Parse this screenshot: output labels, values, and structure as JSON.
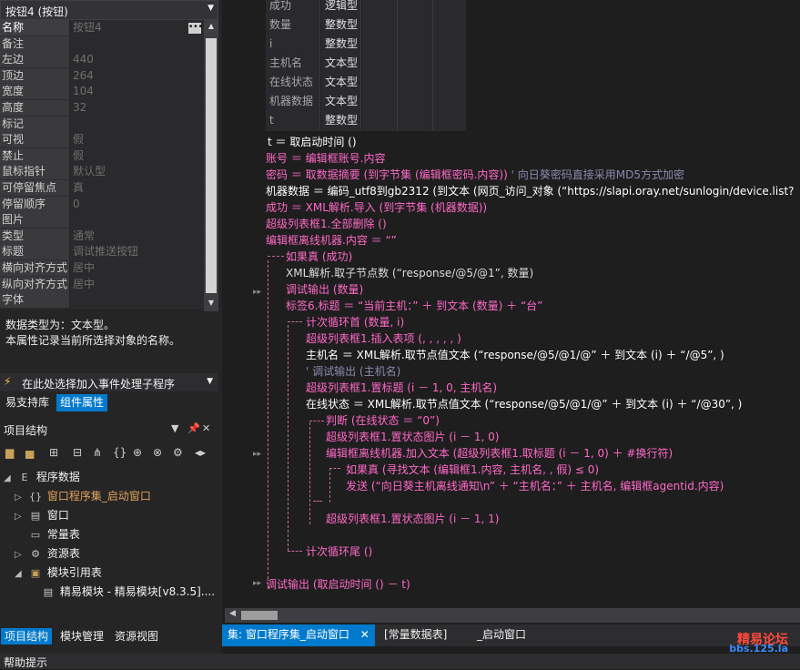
{
  "colors": {
    "accent": "#007acc",
    "keyword": "#ff69c8",
    "comment": "#8a8ab0"
  },
  "properties": {
    "selector": "按钮4 (按钮)",
    "rows": [
      {
        "name": "名称",
        "value": "按钮4"
      },
      {
        "name": "备注",
        "value": ""
      },
      {
        "name": "左边",
        "value": "440"
      },
      {
        "name": "顶边",
        "value": "264"
      },
      {
        "name": "宽度",
        "value": "104"
      },
      {
        "name": "高度",
        "value": "32"
      },
      {
        "name": "标记",
        "value": ""
      },
      {
        "name": "可视",
        "value": "假"
      },
      {
        "name": "禁止",
        "value": "假"
      },
      {
        "name": "鼠标指针",
        "value": "默认型"
      },
      {
        "name": "可停留焦点",
        "value": "真"
      },
      {
        "name": "  停留顺序",
        "value": "0"
      },
      {
        "name": "图片",
        "value": ""
      },
      {
        "name": "类型",
        "value": "通常"
      },
      {
        "name": "标题",
        "value": "调试推送按钮"
      },
      {
        "name": "横向对齐方式",
        "value": "居中"
      },
      {
        "name": "纵向对齐方式",
        "value": "居中"
      },
      {
        "name": "字体",
        "value": ""
      }
    ],
    "ellipsis": "•••",
    "desc1": "数据类型为：文本型。",
    "desc2": "本属性记录当前所选择对象的名称。"
  },
  "event_bar": {
    "icon": "lightning-icon",
    "label": "在此处选择加入事件处理子程序"
  },
  "panel_tabs": [
    "易支持库",
    "组件属性"
  ],
  "project": {
    "title": "项目结构",
    "tree": [
      {
        "label": "程序数据",
        "icon": "E"
      },
      {
        "label": "窗口程序集_启动窗口",
        "icon": "{}"
      },
      {
        "label": "窗口",
        "icon": "▤"
      },
      {
        "label": "常量表",
        "icon": "▭"
      },
      {
        "label": "资源表",
        "icon": "⚙"
      },
      {
        "label": "模块引用表",
        "icon": "▣"
      },
      {
        "label": "精易模块 - 精易模块[v8.3.5]....",
        "icon": "▤"
      }
    ]
  },
  "bottom_tabs": [
    "项目结构",
    "模块管理",
    "资源视图"
  ],
  "help_label": "帮助提示",
  "var_table": [
    {
      "name": "成功",
      "type": "逻辑型"
    },
    {
      "name": "数量",
      "type": "整数型"
    },
    {
      "name": "i",
      "type": "整数型"
    },
    {
      "name": "主机名",
      "type": "文本型"
    },
    {
      "name": "在线状态",
      "type": "文本型"
    },
    {
      "name": "机器数据",
      "type": "文本型"
    },
    {
      "name": "t",
      "type": "整数型"
    }
  ],
  "code": {
    "l1": "t ＝ 取启动时间 ()",
    "l2": "账号 ＝ 编辑框账号.内容",
    "l3a": "密码 ＝ 取数据摘要 (到字节集 (编辑框密码.内容))",
    "l3b": "' 向日葵密码直接采用MD5方式加密",
    "l4": "机器数据 ＝ 编码_utf8到gb2312 (到文本 (网页_访问_对象 (“https://slapi.oray.net/sunlogin/device.list?",
    "l5": "成功 ＝ XML解析.导入 (到字节集 (机器数据))",
    "l6": "超级列表框1.全部删除 ()",
    "l7": "编辑框离线机器.内容 ＝ “”",
    "l8": "如果真 (成功)",
    "l9": "XML解析.取子节点数 (“response/@5/@1”, 数量)",
    "l10": "调试输出 (数量)",
    "l11": "标签6.标题 ＝ “当前主机：” ＋ 到文本 (数量) ＋ “台”",
    "l12": "计次循环首 (数量, i)",
    "l13": "超级列表框1.插入表项 (, , , , , )",
    "l14": "主机名 ＝ XML解析.取节点值文本 (“response/@5/@1/@” ＋ 到文本 (i) ＋ “/@5”, )",
    "l15": "' 调试输出 (主机名)",
    "l16": "超级列表框1.置标题 (i － 1, 0, 主机名)",
    "l17": "在线状态 ＝ XML解析.取节点值文本 (“response/@5/@1/@” ＋ 到文本 (i) ＋ “/@30”, )",
    "l18": "判断 (在线状态 ＝ “0”)",
    "l19": "超级列表框1.置状态图片 (i － 1, 0)",
    "l20": "编辑框离线机器.加入文本 (超级列表框1.取标题 (i － 1, 0) ＋ #换行符)",
    "l21": "如果真 (寻找文本 (编辑框1.内容, 主机名, , 假) ≤ 0)",
    "l22": "发送 (“向日葵主机离线通知\\n” ＋ “主机名：” ＋ 主机名, 编辑框agentid.内容)",
    "l23": "超级列表框1.置状态图片 (i － 1, 1)",
    "l24": "计次循环尾 ()",
    "l25": "调试输出 (取启动时间 () － t)"
  },
  "doc_tabs": [
    "集: 窗口程序集_启动窗口",
    "[常量数据表]",
    "_启动窗口"
  ],
  "watermark": {
    "line1": "精易论坛",
    "line2": "bbs.125.la"
  }
}
